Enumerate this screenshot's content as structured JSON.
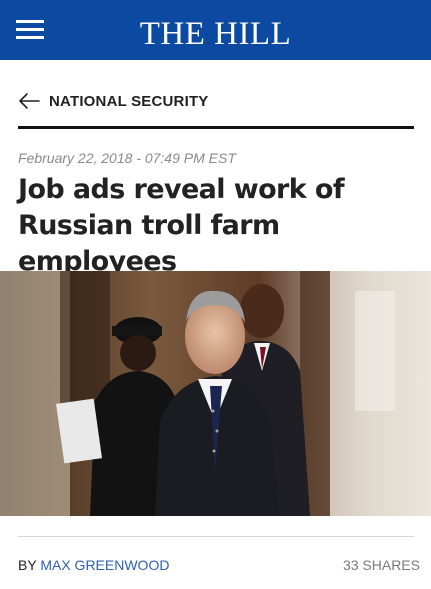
{
  "header": {
    "brand": "THE HILL",
    "menu_icon": "hamburger-menu-icon",
    "background_color": "#0b4aa0"
  },
  "section": {
    "back_icon": "arrow-left-icon",
    "label": "NATIONAL SECURITY"
  },
  "article": {
    "timestamp": "February 22, 2018 - 07:49 PM EST",
    "headline": "Job ads reveal work of Russian troll farm employees",
    "photo": "Man in dark suit walking through doorway followed by other men",
    "byline_prefix": "BY",
    "author": "MAX GREENWOOD",
    "shares": "33 SHARES"
  },
  "colors": {
    "link": "#2f5fb3",
    "timestamp": "#8a8a8a"
  }
}
